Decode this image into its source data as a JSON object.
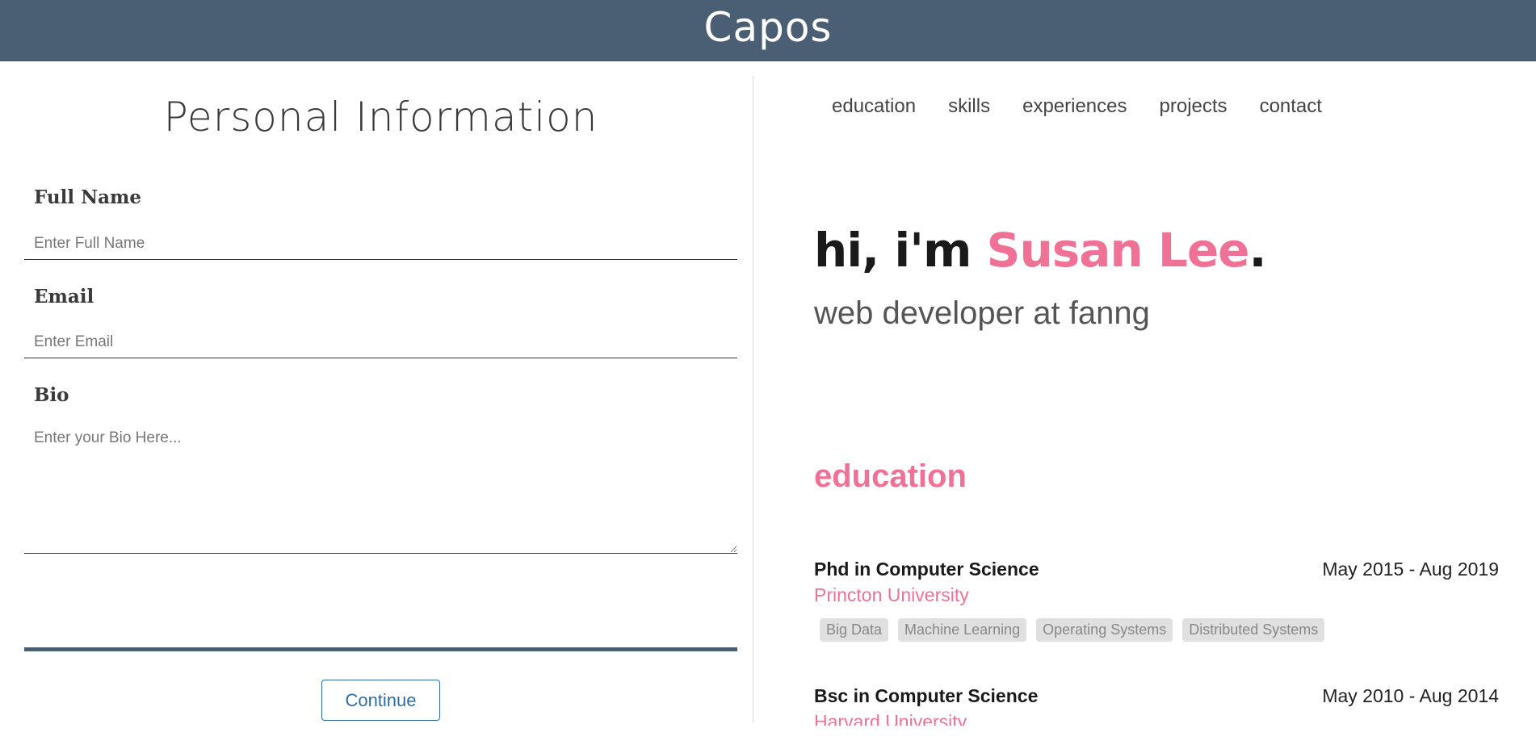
{
  "header": {
    "brand": "Capos"
  },
  "form": {
    "title": "Personal Information",
    "full_name": {
      "label": "Full Name",
      "placeholder": "Enter Full Name",
      "value": ""
    },
    "email": {
      "label": "Email",
      "placeholder": "Enter Email",
      "value": ""
    },
    "bio": {
      "label": "Bio",
      "placeholder": "Enter your Bio Here...",
      "value": ""
    },
    "continue_label": "Continue"
  },
  "colors": {
    "header_bg": "#4a5f73",
    "accent": "#ef7196",
    "button": "#2e6da4"
  },
  "preview": {
    "nav": [
      "education",
      "skills",
      "experiences",
      "projects",
      "contact"
    ],
    "hero": {
      "prefix": "hi, i'm ",
      "name": "Susan Lee",
      "suffix": ".",
      "subtitle": "web developer at fanng"
    },
    "education": {
      "title": "education",
      "items": [
        {
          "degree": "Phd in Computer Science",
          "dates": "May 2015 - Aug 2019",
          "school": "Princton University",
          "tags": [
            "Big Data",
            "Machine Learning",
            "Operating Systems",
            "Distributed Systems"
          ]
        },
        {
          "degree": "Bsc in Computer Science",
          "dates": "May 2010 - Aug 2014",
          "school": "Harvard University",
          "tags": []
        }
      ]
    }
  }
}
